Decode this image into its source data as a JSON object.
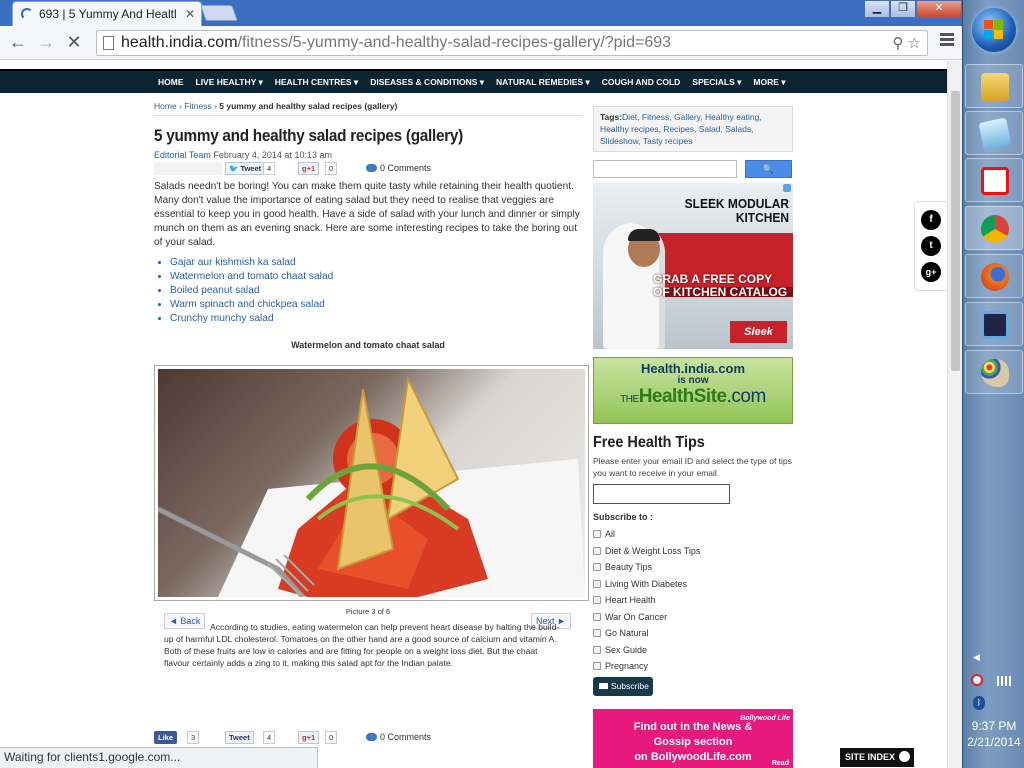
{
  "browser": {
    "tab_title": "693 | 5 Yummy And Healtl",
    "url_host": "health.india.com",
    "url_path": "/fitness/5-yummy-and-healthy-salad-recipes-gallery/?pid=693",
    "status_text": "Waiting for clients1.google.com..."
  },
  "nav": [
    "HOME",
    "LIVE HEALTHY ▾",
    "HEALTH CENTRES ▾",
    "DISEASES & CONDITIONS ▾",
    "NATURAL REMEDIES ▾",
    "COUGH AND COLD",
    "SPECIALS ▾",
    "MORE ▾"
  ],
  "article": {
    "breadcrumb": {
      "home": "Home",
      "sep": "›",
      "section": "Fitness",
      "current": "5 yummy and healthy salad recipes (gallery)"
    },
    "title": "5 yummy and healthy salad recipes (gallery)",
    "author": "Editorial Team",
    "date": "February 4, 2014 at 10:13 am",
    "share": {
      "tweet": "Tweet",
      "tweet_count": "4",
      "gplus": "g+1",
      "gplus_count": "0",
      "comments": "0 Comments",
      "like": "Like",
      "like_count": "3"
    },
    "intro": "Salads needn't be boring! You can make them quite tasty while retaining their health quotient. Many don't value the importance of eating salad but they need to realise that veggies are essential to keep you in good health. Have a side of salad with your lunch and dinner or simply munch on them as an evening snack. Here are some interesting recipes to take the boring out of your salad.",
    "recipes": [
      "Gajar aur kishmish ka salad",
      "Watermelon and tomato chaat salad",
      "Boiled peanut salad",
      "Warm spinach and chickpea salad",
      "Crunchy munchy salad"
    ],
    "caption": "Watermelon and tomato chaat salad",
    "gallery": {
      "back": "◄ Back",
      "next": "Next ►",
      "picture_num": "Picture 3 of 6",
      "text": "According to studies, eating watermelon can help prevent heart disease by halting the build-up of harmful LDL cholesterol. Tomatoes on the other hand are a good source of calcium and vitamin A. Both of these fruits are low in calories and are fitting for people on a weight loss diet. But the chaat flavour certainly adds a zing to it, making this salad apt for the Indian palate."
    }
  },
  "sidebar": {
    "tags_label": "Tags:",
    "tags": "Diet, Fitness, Gallery, Healthy eating, Healthy recipes, Recipes, Salad, Salads, Slideshow, Tasty recipes",
    "search_button": "🔍",
    "ad_kitchen": {
      "headline": "SLEEK MODULAR KITCHEN",
      "grab": "GRAB A FREE COPY OF KITCHEN CATALOG",
      "logo": "Sleek"
    },
    "ad_healthsite": {
      "l1": "Health.india.com",
      "l2": "is now",
      "l3a": "THE",
      "l3b": "HealthSite",
      "l3c": ".com"
    },
    "tips_title": "Free Health Tips",
    "tips_desc": "Please enter your email ID and select the type of tips you want to receive in your email.",
    "subscribe_to": "Subscribe to :",
    "options": [
      "All",
      "Diet & Weight Loss Tips",
      "Beauty Tips",
      "Living With Diabetes",
      "Heart Health",
      "War On Cancer",
      "Go Natural",
      "Sex Guide",
      "Pregnancy"
    ],
    "subscribe_button": "Subscribe",
    "ad_bollywood": {
      "l1": "Find out in the News &",
      "l2": "Gossip section",
      "l3": "on BollywoodLife.com",
      "brand": "Bollywood Life",
      "more": "Read"
    }
  },
  "social": [
    "f",
    "t",
    "g+"
  ],
  "site_index": "SITE INDEX",
  "taskbar": {
    "time": "9:37 PM",
    "date": "2/21/2014"
  }
}
